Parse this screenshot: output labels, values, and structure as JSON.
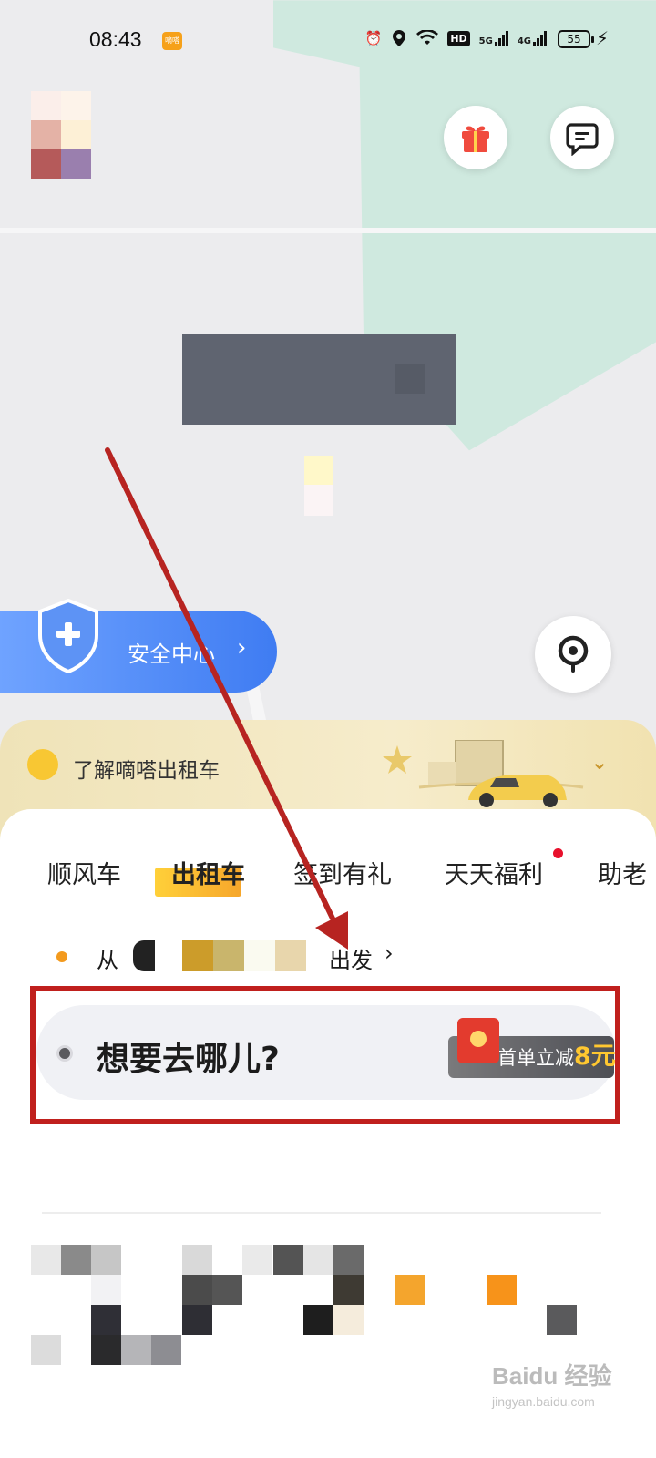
{
  "status_bar": {
    "time": "08:43",
    "badge": "嘀嗒",
    "battery": "55",
    "hd": "HD",
    "net1": "5G",
    "net2": "4G"
  },
  "header": {
    "gift_icon": "gift-icon",
    "message_icon": "message-icon"
  },
  "safety": {
    "label": "安全中心",
    "chevron": "›"
  },
  "promo": {
    "text": "了解嘀嗒出租车",
    "chevron": "⌄"
  },
  "tabs": [
    {
      "label": "顺风车",
      "active": false
    },
    {
      "label": "出租车",
      "active": true
    },
    {
      "label": "签到有礼",
      "active": false
    },
    {
      "label": "天天福利",
      "active": false,
      "badge_dot": true
    },
    {
      "label": "助老",
      "active": false
    }
  ],
  "route": {
    "from_label": "从",
    "depart_label": "出发",
    "chevron": "›"
  },
  "destination": {
    "placeholder": "想要去哪儿?",
    "coupon_text": "首单立减",
    "coupon_amount": "8元"
  },
  "watermark": {
    "brand": "Baidu 经验",
    "site": "jingyan.baidu.com"
  },
  "colors": {
    "accent": "#f6a62b",
    "safety_blue": "#3f7cf2",
    "highlight_red": "#c0201d"
  }
}
